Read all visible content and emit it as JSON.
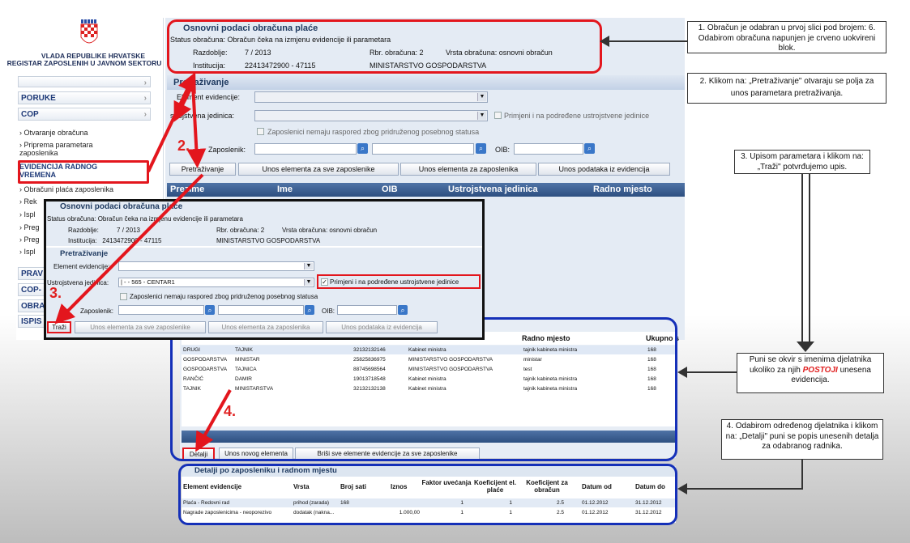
{
  "sidebar": {
    "republic": "VLADA REPUBLIKE HRVATSKE",
    "registry": "REGISTAR ZAPOSLENIH U JAVNOM SEKTORU",
    "menu": [
      "PORUKE",
      "COP"
    ],
    "cop_items": [
      "Otvaranje obračuna",
      "Priprema parametara zaposlenika",
      "EVIDENCIJA RADNOG VREMENA",
      "Obračuni plaća zaposlenika",
      "Rek",
      "Ispl",
      "Preg",
      "Preg",
      "Ispl"
    ],
    "lower_menu": [
      "PRAV",
      "COP-",
      "OBRA",
      "ISPIS"
    ]
  },
  "osnovni": {
    "title": "Osnovni podaci obračuna plaće",
    "status": "Status obračuna: Obračun čeka na izmjenu evidencije ili parametara",
    "razdoblje_label": "Razdoblje:",
    "razdoblje": "7 / 2013",
    "rbr_label": "Rbr. obračuna: 2",
    "vrsta": "Vrsta obračuna: osnovni obračun",
    "institucija_label": "Institucija:",
    "institucija": "22413472900 - 47115",
    "ministarstvo": "MINISTARSTVO GOSPODARSTVA"
  },
  "pretrazivanje": {
    "title": "Pretraživanje",
    "element": "Element evidencije:",
    "ustroj": "Ustrojstvena jedinica:",
    "ustroj_short": "strojstvena jedinica:",
    "primjeni": "Primjeni i na podređene ustrojstvene jedinice",
    "nemaju": "Zaposlenici nemaju raspored zbog pridruženog posebnog statusa",
    "zaposlenik": "Zaposlenik:",
    "oib": "OIB:",
    "btn_pretraz": "Pretraživanje",
    "btn_unos_svi": "Unos elementa za sve zaposlenike",
    "btn_unos": "Unos elementa za zaposlenika",
    "btn_unos_pod": "Unos podataka iz evidencija"
  },
  "results_header": [
    "Prezime",
    "Ime",
    "OIB",
    "Ustrojstvena jedinica",
    "Radno mjesto"
  ],
  "popup": {
    "title_a": "Osnovni podaci ",
    "title_b": "obračuna plaće",
    "status_a": "Status obračuna: Ob",
    "status_b": "račun čeka na izmjenu evidencije ili parametara",
    "razdoblje_a": "Razdoblje:",
    "razdoblje_b": "7 / 2013",
    "rbr": "Rbr. obračuna: 2",
    "vrsta": "Vrsta obračuna: osnovni obračun",
    "institucija_a": "Institucija:",
    "institucija_b": "2413472900 - 47115",
    "ministarstvo": "MINISTARSTVO GOSPODARSTVA",
    "pretraz": "Pretraživanje",
    "element": "Element evidencije:",
    "ustroj": "Ustrojstvena jedinica:",
    "ustroj_value": "| - - 565 - CENTAR1",
    "primjeni": "Primjeni i na podređene ustrojstvene jedinice",
    "nemaju": "Zaposlenici nemaju raspored zbog pridruženog posebnog statusa",
    "zaposlenik": "Zaposlenik:",
    "oib": "OIB:",
    "trazi": "Traži",
    "unos_svi": "Unos elementa za sve zaposlenike",
    "unos": "Unos elementa za zaposlenika",
    "unos_pod": "Unos podataka iz evidencija"
  },
  "table2": {
    "headers": [
      "Radno mjesto",
      "Ukupno s"
    ],
    "rows": [
      [
        "DRUGI",
        "TAJNIK",
        "32132132146",
        "Kabinet ministra",
        "tajnik kabineta ministra",
        "168"
      ],
      [
        "GOSPODARSTVA",
        "MINISTAR",
        "25825836975",
        "MINISTARSTVO GOSPODARSTVA",
        "ministar",
        "168"
      ],
      [
        "GOSPODARSTVA",
        "TAJNICA",
        "88745698564",
        "MINISTARSTVO GOSPODARSTVA",
        "test",
        "168"
      ],
      [
        "RANČIĆ",
        "DAMIR",
        "19013718548",
        "Kabinet ministra",
        "tajnik kabineta ministra",
        "168"
      ],
      [
        "TAJNIK",
        "MINISTARSTVA",
        "32132132138",
        "Kabinet ministra",
        "tajnik kabineta ministra",
        "168"
      ]
    ],
    "btn_detalji": "Detalji",
    "btn_novi": "Unos novog elementa",
    "btn_brisi": "Briši sve elemente evidencije za sve zaposlenike"
  },
  "detalji": {
    "title": "Detalji po zaposleniku i radnom mjestu",
    "headers": [
      "Element evidencije",
      "Vrsta",
      "Broj sati",
      "Iznos",
      "Faktor uvećanja",
      "Koeficijent el. plaće",
      "Koeficijent za obračun",
      "Datum od",
      "Datum do"
    ],
    "rows": [
      [
        "Plaća - Redovni rad",
        "prihod (zarada)",
        "168",
        "",
        "1",
        "1",
        "2.5",
        "01.12.2012",
        "31.12.2012"
      ],
      [
        "Nagrade zaposlenicima - neoporezivo",
        "dodatak (nakna...",
        "",
        "1.000,00",
        "1",
        "1",
        "2.5",
        "01.12.2012",
        "31.12.2012"
      ]
    ]
  },
  "steps": {
    "s2": "2.",
    "s3": "3.",
    "s4": "4."
  },
  "callouts": {
    "c1": "1. Obračun je odabran u prvoj slici pod brojem: 6. Odabirom obračuna napunjen je  crveno uokvireni blok.",
    "c2": "2. Klikom na: „Pretraživanje\" otvaraju se polja za unos parametara pretraživanja.",
    "c3": "3. Upisom parametara i klikom na: „Traži\" potvrđujemo upis.",
    "c4a": "Puni se okvir s imenima djelatnika ukoliko za njih ",
    "c4b": "POSTOJI",
    "c4c": " unesena evidencija.",
    "c5": "4. Odabirom određenog djelatnika i klikom na: „Detalji\" puni se popis unesenih detalja za odabranog radnika."
  }
}
